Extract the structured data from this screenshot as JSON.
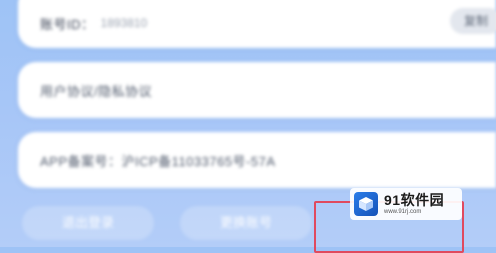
{
  "account": {
    "label": "账号ID：",
    "value": "1893810",
    "copy_label": "复制"
  },
  "agreement": {
    "label": "用户协议/隐私协议"
  },
  "filing": {
    "label": "APP备案号：沪ICP备11033765号-57A"
  },
  "actions": {
    "logout_label": "退出登录",
    "switch_label": "更换账号"
  },
  "watermark": {
    "brand": "91软件园",
    "url": "www.91rj.com"
  }
}
